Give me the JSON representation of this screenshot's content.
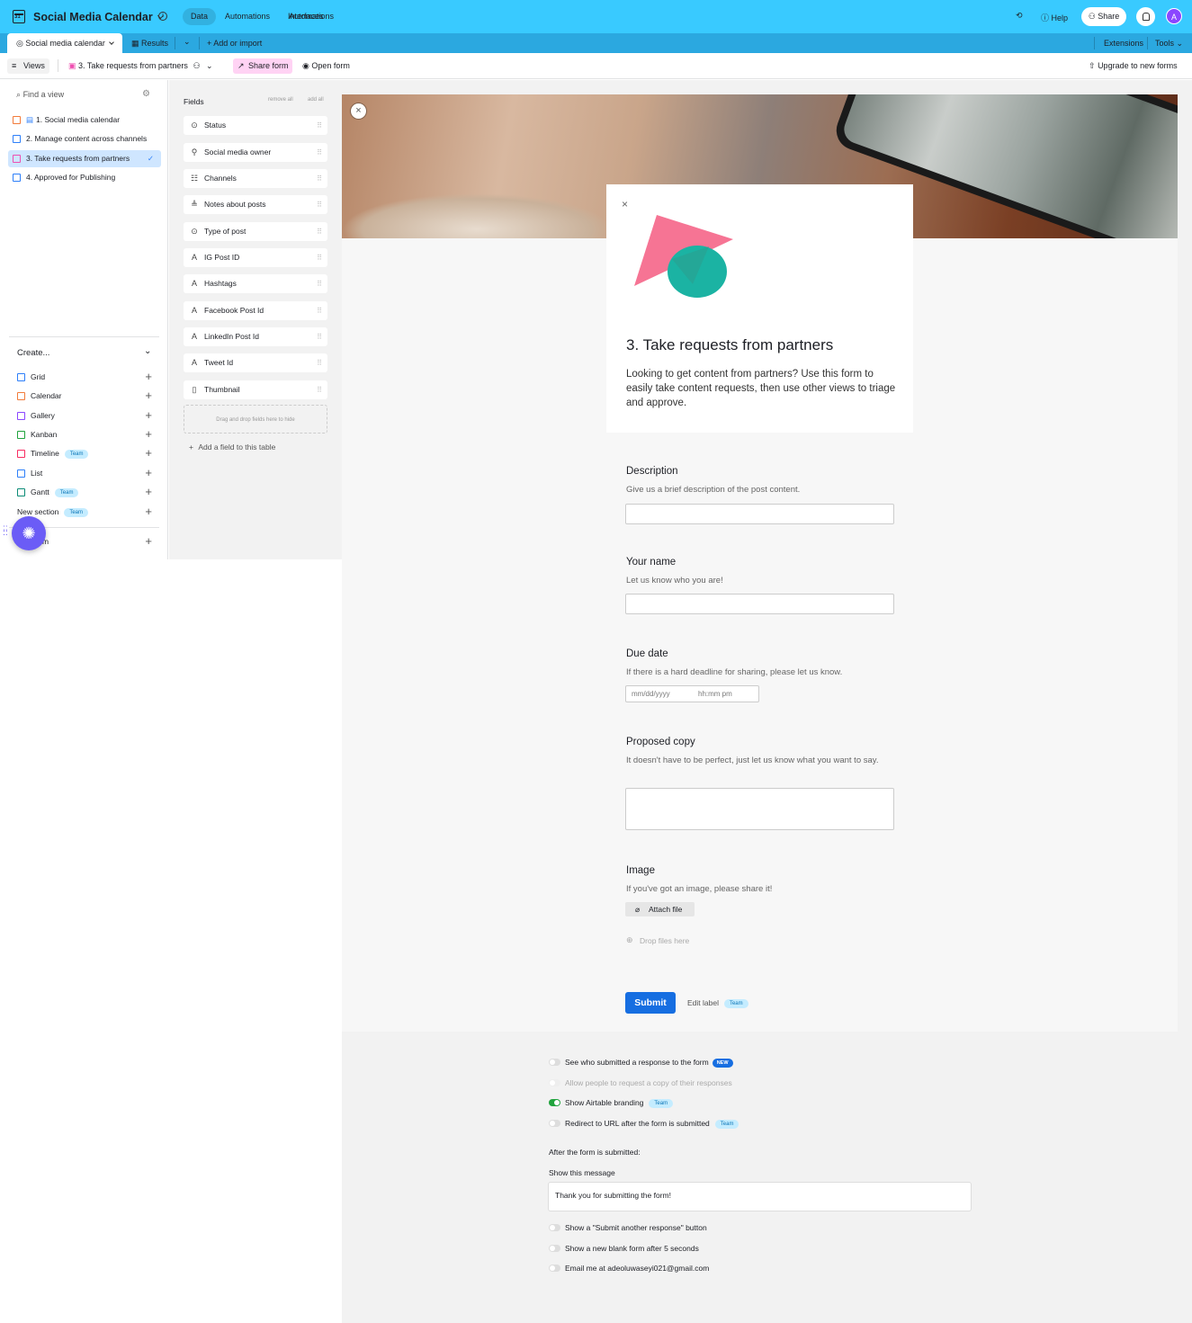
{
  "header": {
    "base_title": "Social Media Calendar",
    "nav": [
      "Data",
      "Automations",
      "Interfaces"
    ],
    "help": "Help",
    "share": "Share",
    "avatar_initial": "A"
  },
  "tabs": {
    "active": "Social media calendar",
    "results": "Results",
    "add_import": "Add or import",
    "extensions": "Extensions",
    "tools": "Tools"
  },
  "toolbar": {
    "views": "Views",
    "current_view": "3. Take requests from partners",
    "share_form": "Share form",
    "open_form": "Open form",
    "upgrade": "Upgrade to new forms"
  },
  "sidebar": {
    "find_placeholder": "Find a view",
    "views": [
      "1. Social media calendar",
      "2. Manage content across channels",
      "3. Take requests from partners",
      "4. Approved for Publishing"
    ],
    "create_label": "Create...",
    "create_items": [
      "Grid",
      "Calendar",
      "Gallery",
      "Kanban",
      "Timeline",
      "List",
      "Gantt",
      "New section"
    ],
    "team_badge": "Team",
    "form_item": "m"
  },
  "fields": {
    "title": "Fields",
    "remove_all": "remove all",
    "add_all": "add all",
    "items": [
      "Status",
      "Social media owner",
      "Channels",
      "Notes about posts",
      "Type of post",
      "IG Post ID",
      "Hashtags",
      "Facebook Post Id",
      "LinkedIn Post Id",
      "Tweet Id",
      "Thumbnail"
    ],
    "drop_zone": "Drag and drop fields here to hide",
    "add_field": "Add a field to this table"
  },
  "form": {
    "title": "3. Take requests from partners",
    "description": "Looking to get content from partners? Use this form to easily take content requests, then use other views to triage and approve.",
    "questions": [
      {
        "label": "Description",
        "help": "Give us a brief description of the post content."
      },
      {
        "label": "Your name",
        "help": "Let us know who you are!"
      },
      {
        "label": "Due date",
        "help": "If there is a hard deadline for sharing, please let us know."
      },
      {
        "label": "Proposed copy",
        "help": "It doesn't have to be perfect, just let us know what you want to say."
      },
      {
        "label": "Image",
        "help": "If you've got an image, please share it!"
      }
    ],
    "date_placeholder": "mm/dd/yyyy",
    "time_placeholder": "hh:mm pm",
    "attach_file": "Attach file",
    "drop_files": "Drop files here",
    "submit": "Submit",
    "edit_label": "Edit label"
  },
  "settings": {
    "options": [
      {
        "label": "See who submitted a response to the form",
        "on": false
      },
      {
        "label": "Allow people to request a copy of their responses",
        "on": false
      },
      {
        "label": "Show Airtable branding",
        "on": true
      },
      {
        "label": "Redirect to URL after the form is submitted",
        "on": false
      }
    ],
    "new_badge": "NEW",
    "after_submit": "After the form is submitted:",
    "show_message": "Show this message",
    "message_value": "Thank you for submitting the form!",
    "more_options": [
      "Show a \"Submit another response\" button",
      "Show a new blank form after 5 seconds",
      "Email me at adeoluwaseyi021@gmail.com"
    ]
  },
  "colors": {
    "topbar": "#39caff",
    "tabbar": "#2ba8e0",
    "submit": "#166ee1",
    "share_form": "#ffd3f4"
  }
}
